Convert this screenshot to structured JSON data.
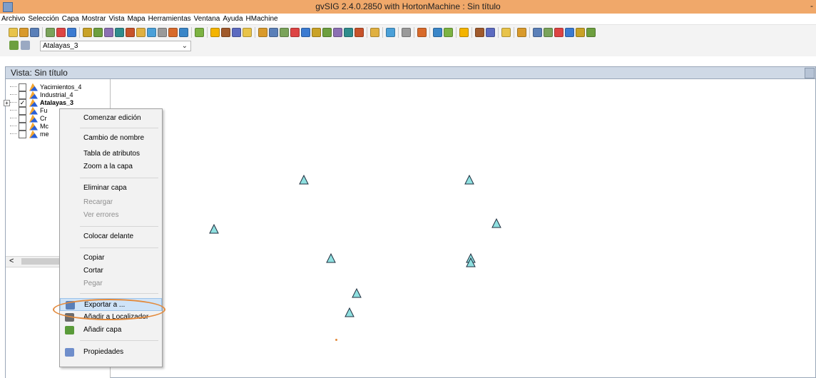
{
  "window": {
    "title": "gvSIG 2.4.0.2850 with HortonMachine : Sin título",
    "min_glyph": "-"
  },
  "menubar": [
    "Archivo",
    "Selección",
    "Capa",
    "Mostrar",
    "Vista",
    "Mapa",
    "Herramientas",
    "Ventana",
    "Ayuda",
    "HMachine"
  ],
  "toolbar": {
    "layer_select_value": "Atalayas_3",
    "icon_colors": [
      "#e8c34a",
      "#d99a2b",
      "#5a7fb8",
      "#7aa35a",
      "#d44",
      "#3b7bd1",
      "#c9a227",
      "#6d9f3f",
      "#8b6fb3",
      "#2f8c8c",
      "#c7522a",
      "#e0b040",
      "#4aa0d8",
      "#9a9a9a",
      "#d86a2a",
      "#3a86c8",
      "#7cb342",
      "#f4b400",
      "#a05a2c",
      "#5c6bc0"
    ]
  },
  "view": {
    "title": "Vista: Sin título"
  },
  "toc": {
    "layers": [
      {
        "name": "Yacimientos_4",
        "checked": false
      },
      {
        "name": "Industrial_4",
        "checked": false
      },
      {
        "name": "Atalayas_3",
        "checked": true,
        "bold": true
      },
      {
        "name": "Fu",
        "checked": false
      },
      {
        "name": "Cr",
        "checked": false
      },
      {
        "name": "Mc",
        "checked": false
      },
      {
        "name": "me",
        "checked": false
      }
    ],
    "expander_glyph": "+",
    "check_glyph": "✓",
    "scroll_left_glyph": "<"
  },
  "context_menu": {
    "items": [
      {
        "label": "Comenzar edición",
        "enabled": true
      },
      {
        "label": "Cambio de nombre",
        "enabled": true
      },
      {
        "label": "Tabla de atributos",
        "enabled": true
      },
      {
        "label": "Zoom a la capa",
        "enabled": true
      },
      {
        "label": "Eliminar capa",
        "enabled": true
      },
      {
        "label": "Recargar",
        "enabled": false
      },
      {
        "label": "Ver errores",
        "enabled": false
      },
      {
        "label": "Colocar delante",
        "enabled": true
      },
      {
        "label": "Copiar",
        "enabled": true
      },
      {
        "label": "Cortar",
        "enabled": true
      },
      {
        "label": "Pegar",
        "enabled": false
      },
      {
        "label": "Exportar a ...",
        "enabled": true,
        "selected": true,
        "icon": "export-icon"
      },
      {
        "label": "Añadir a Localizador",
        "enabled": true,
        "icon": "locator-icon"
      },
      {
        "label": "Añadir capa",
        "enabled": true,
        "icon": "add-layer-icon"
      },
      {
        "label": "Propiedades",
        "enabled": true,
        "icon": "properties-icon"
      }
    ],
    "highlight_color": "#e38a3c"
  },
  "map": {
    "point_symbol": "triangle",
    "fill_color": "#8fe0e0",
    "stroke_color": "#1f2f3f",
    "feature_count": 11
  }
}
